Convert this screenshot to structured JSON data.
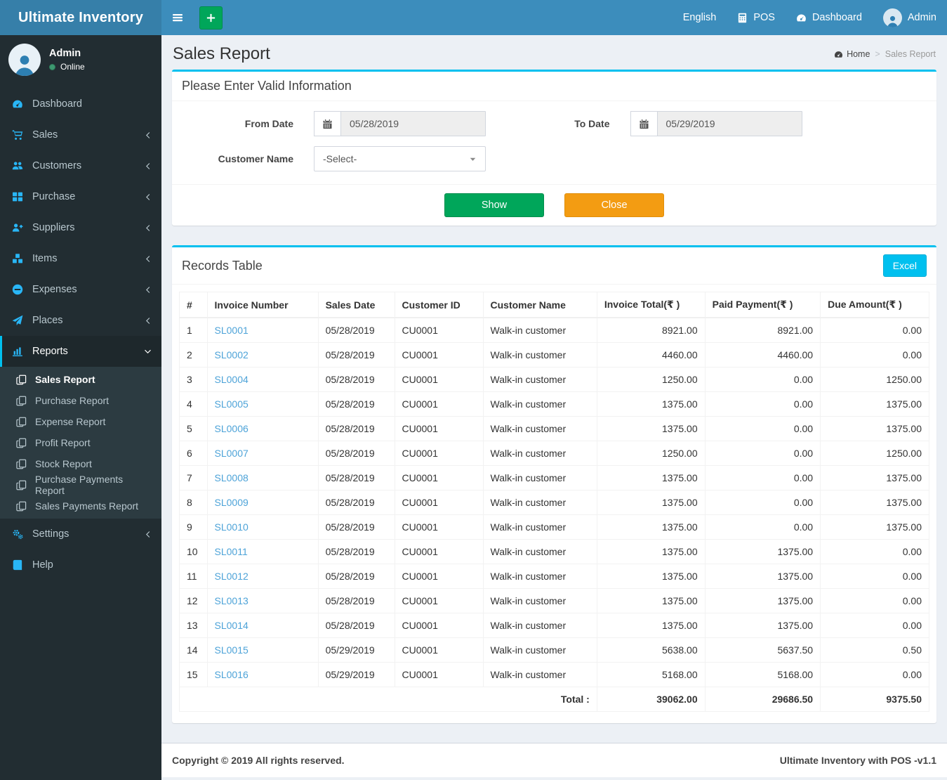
{
  "app": {
    "brand": "Ultimate Inventory"
  },
  "navbar": {
    "language": "English",
    "pos_label": "POS",
    "dashboard_label": "Dashboard",
    "user_label": "Admin"
  },
  "sidebar": {
    "user_name": "Admin",
    "user_status": "Online",
    "menu": [
      {
        "label": "Dashboard",
        "icon": "tachometer-icon",
        "chevron": ""
      },
      {
        "label": "Sales",
        "icon": "cart-icon",
        "chevron": "left"
      },
      {
        "label": "Customers",
        "icon": "users-icon",
        "chevron": "left"
      },
      {
        "label": "Purchase",
        "icon": "grid-icon",
        "chevron": "left"
      },
      {
        "label": "Suppliers",
        "icon": "user-plus-icon",
        "chevron": "left"
      },
      {
        "label": "Items",
        "icon": "cubes-icon",
        "chevron": "left"
      },
      {
        "label": "Expenses",
        "icon": "minus-circle-icon",
        "chevron": "left"
      },
      {
        "label": "Places",
        "icon": "paper-plane-icon",
        "chevron": "left"
      },
      {
        "label": "Reports",
        "icon": "bar-chart-icon",
        "chevron": "down",
        "active": true,
        "submenu": [
          {
            "label": "Sales Report",
            "active": true
          },
          {
            "label": "Purchase Report"
          },
          {
            "label": "Expense Report"
          },
          {
            "label": "Profit Report"
          },
          {
            "label": "Stock Report"
          },
          {
            "label": "Purchase Payments Report"
          },
          {
            "label": "Sales Payments Report"
          }
        ]
      },
      {
        "label": "Settings",
        "icon": "gears-icon",
        "chevron": "left"
      },
      {
        "label": "Help",
        "icon": "book-icon",
        "chevron": ""
      }
    ]
  },
  "page": {
    "title": "Sales Report",
    "breadcrumb_home": "Home",
    "breadcrumb_current": "Sales Report"
  },
  "filter": {
    "title": "Please Enter Valid Information",
    "from_date_label": "From Date",
    "from_date_value": "05/28/2019",
    "to_date_label": "To Date",
    "to_date_value": "05/29/2019",
    "customer_label": "Customer Name",
    "customer_value": "-Select-",
    "show_label": "Show",
    "close_label": "Close"
  },
  "records": {
    "title": "Records Table",
    "excel_label": "Excel",
    "columns": [
      "#",
      "Invoice Number",
      "Sales Date",
      "Customer ID",
      "Customer Name",
      "Invoice Total(₹ )",
      "Paid Payment(₹ )",
      "Due Amount(₹ )"
    ],
    "rows": [
      {
        "n": "1",
        "invoice": "SL0001",
        "date": "05/28/2019",
        "cust_id": "CU0001",
        "cust_name": "Walk-in customer",
        "total": "8921.00",
        "paid": "8921.00",
        "due": "0.00"
      },
      {
        "n": "2",
        "invoice": "SL0002",
        "date": "05/28/2019",
        "cust_id": "CU0001",
        "cust_name": "Walk-in customer",
        "total": "4460.00",
        "paid": "4460.00",
        "due": "0.00"
      },
      {
        "n": "3",
        "invoice": "SL0004",
        "date": "05/28/2019",
        "cust_id": "CU0001",
        "cust_name": "Walk-in customer",
        "total": "1250.00",
        "paid": "0.00",
        "due": "1250.00"
      },
      {
        "n": "4",
        "invoice": "SL0005",
        "date": "05/28/2019",
        "cust_id": "CU0001",
        "cust_name": "Walk-in customer",
        "total": "1375.00",
        "paid": "0.00",
        "due": "1375.00"
      },
      {
        "n": "5",
        "invoice": "SL0006",
        "date": "05/28/2019",
        "cust_id": "CU0001",
        "cust_name": "Walk-in customer",
        "total": "1375.00",
        "paid": "0.00",
        "due": "1375.00"
      },
      {
        "n": "6",
        "invoice": "SL0007",
        "date": "05/28/2019",
        "cust_id": "CU0001",
        "cust_name": "Walk-in customer",
        "total": "1250.00",
        "paid": "0.00",
        "due": "1250.00"
      },
      {
        "n": "7",
        "invoice": "SL0008",
        "date": "05/28/2019",
        "cust_id": "CU0001",
        "cust_name": "Walk-in customer",
        "total": "1375.00",
        "paid": "0.00",
        "due": "1375.00"
      },
      {
        "n": "8",
        "invoice": "SL0009",
        "date": "05/28/2019",
        "cust_id": "CU0001",
        "cust_name": "Walk-in customer",
        "total": "1375.00",
        "paid": "0.00",
        "due": "1375.00"
      },
      {
        "n": "9",
        "invoice": "SL0010",
        "date": "05/28/2019",
        "cust_id": "CU0001",
        "cust_name": "Walk-in customer",
        "total": "1375.00",
        "paid": "0.00",
        "due": "1375.00"
      },
      {
        "n": "10",
        "invoice": "SL0011",
        "date": "05/28/2019",
        "cust_id": "CU0001",
        "cust_name": "Walk-in customer",
        "total": "1375.00",
        "paid": "1375.00",
        "due": "0.00"
      },
      {
        "n": "11",
        "invoice": "SL0012",
        "date": "05/28/2019",
        "cust_id": "CU0001",
        "cust_name": "Walk-in customer",
        "total": "1375.00",
        "paid": "1375.00",
        "due": "0.00"
      },
      {
        "n": "12",
        "invoice": "SL0013",
        "date": "05/28/2019",
        "cust_id": "CU0001",
        "cust_name": "Walk-in customer",
        "total": "1375.00",
        "paid": "1375.00",
        "due": "0.00"
      },
      {
        "n": "13",
        "invoice": "SL0014",
        "date": "05/28/2019",
        "cust_id": "CU0001",
        "cust_name": "Walk-in customer",
        "total": "1375.00",
        "paid": "1375.00",
        "due": "0.00"
      },
      {
        "n": "14",
        "invoice": "SL0015",
        "date": "05/29/2019",
        "cust_id": "CU0001",
        "cust_name": "Walk-in customer",
        "total": "5638.00",
        "paid": "5637.50",
        "due": "0.50"
      },
      {
        "n": "15",
        "invoice": "SL0016",
        "date": "05/29/2019",
        "cust_id": "CU0001",
        "cust_name": "Walk-in customer",
        "total": "5168.00",
        "paid": "5168.00",
        "due": "0.00"
      }
    ],
    "total_label": "Total :",
    "total_invoice": "39062.00",
    "total_paid": "29686.50",
    "total_due": "9375.50"
  },
  "footer": {
    "left": "Copyright © 2019 All rights reserved.",
    "right": "Ultimate Inventory with POS -v1.1"
  },
  "colors": {
    "navbar_blue": "#3c8dbc",
    "logo_blue": "#367fa9",
    "sidebar_dark": "#222d32",
    "accent_cyan": "#00c0ef",
    "sidebar_icon_blue": "#29b6f6",
    "success_green": "#00a65a",
    "warning_orange": "#f39c12",
    "online_green": "#3d9970",
    "link_blue": "#4da3d8"
  }
}
